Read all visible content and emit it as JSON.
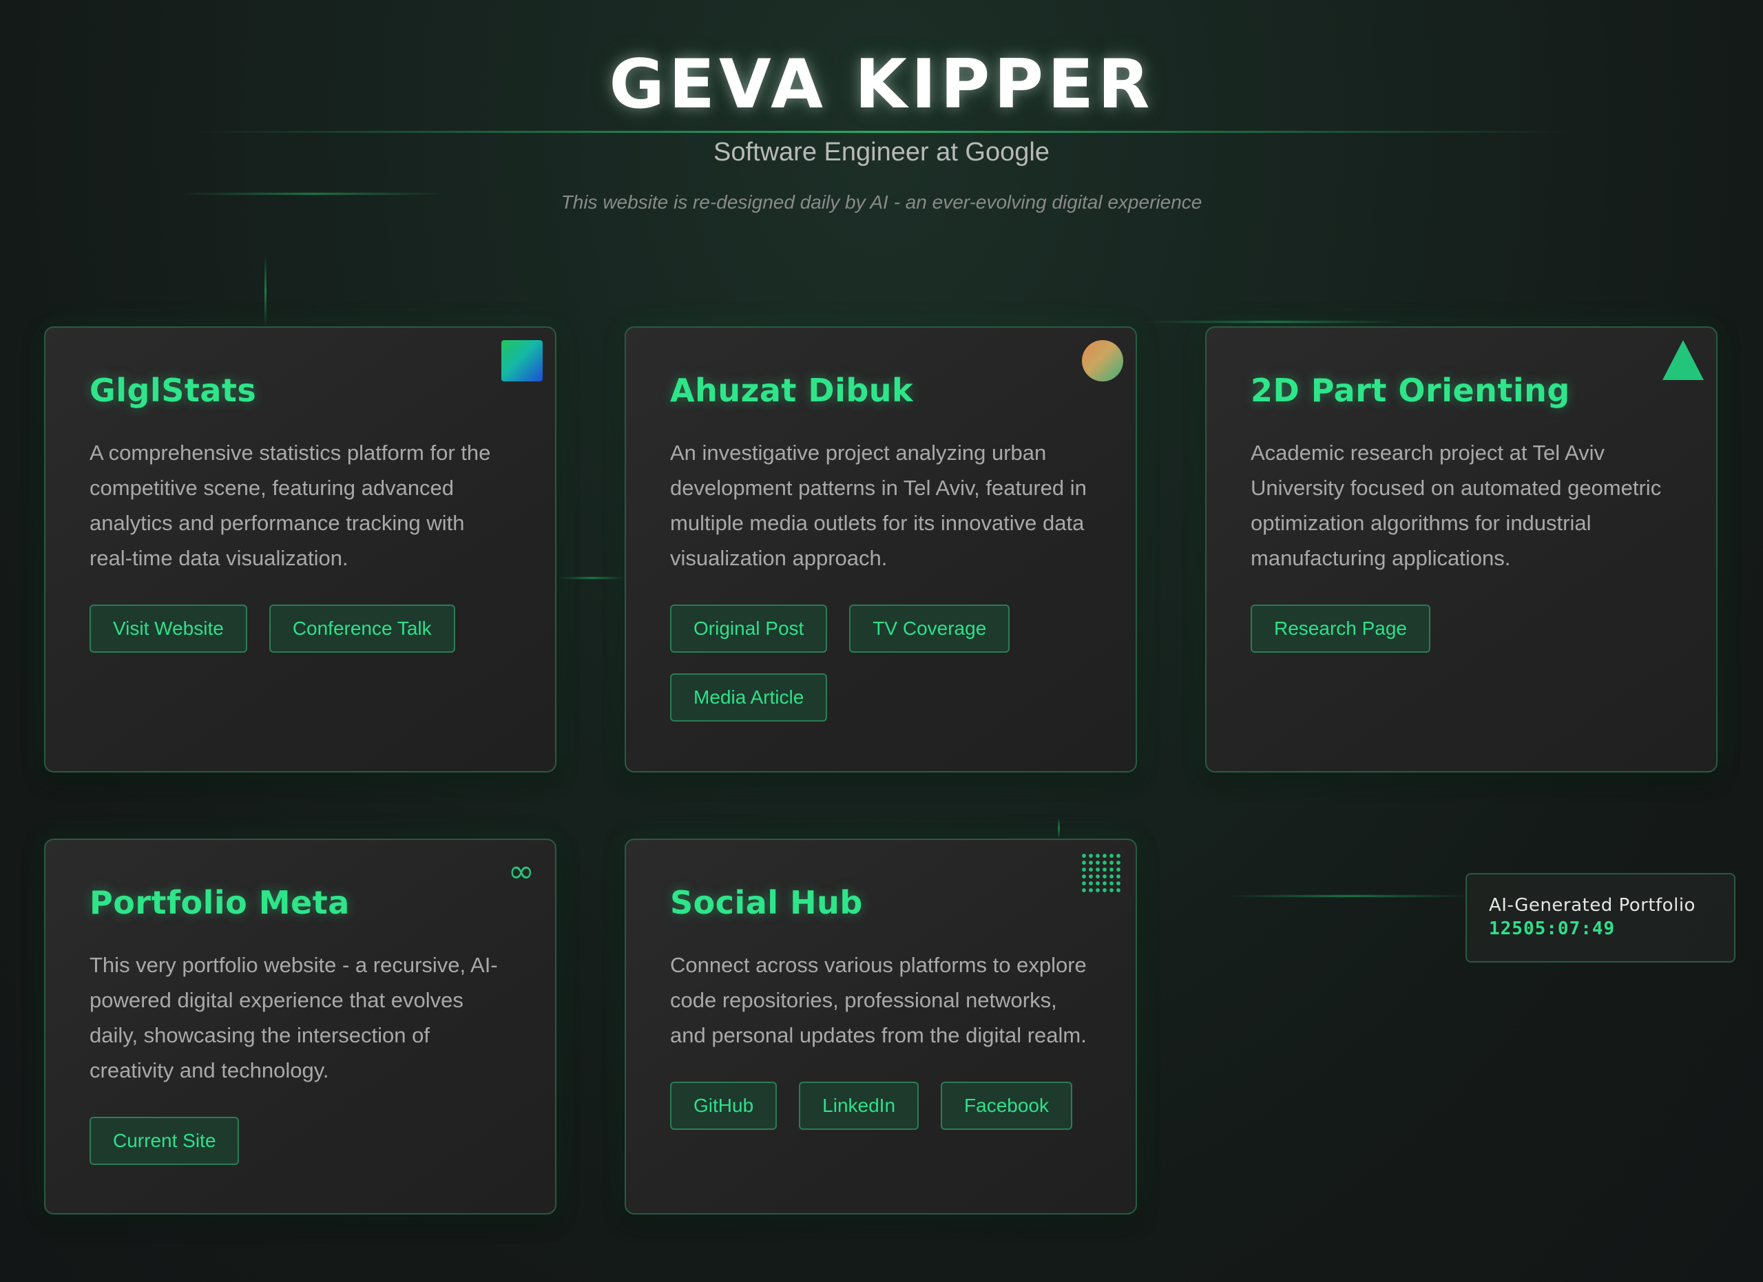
{
  "header": {
    "title": "GEVA KIPPER",
    "subtitle": "Software Engineer at Google",
    "tagline": "This website is re-designed daily by AI - an ever-evolving digital experience"
  },
  "cards": [
    {
      "title": "GlglStats",
      "description": "A comprehensive statistics platform for the competitive scene, featuring advanced analytics and performance tracking with real-time data visualization.",
      "icon": "gradient-square-icon",
      "buttons": [
        "Visit Website",
        "Conference Talk"
      ]
    },
    {
      "title": "Ahuzat Dibuk",
      "description": "An investigative project analyzing urban development patterns in Tel Aviv, featured in multiple media outlets for its innovative data visualization approach.",
      "icon": "gradient-circle-icon",
      "buttons": [
        "Original Post",
        "TV Coverage",
        "Media Article"
      ]
    },
    {
      "title": "2D Part Orienting",
      "description": "Academic research project at Tel Aviv University focused on automated geometric optimization algorithms for industrial manufacturing applications.",
      "icon": "triangle-icon",
      "buttons": [
        "Research Page"
      ]
    },
    {
      "title": "Portfolio Meta",
      "description": "This very portfolio website - a recursive, AI-powered digital experience that evolves daily, showcasing the intersection of creativity and technology.",
      "icon": "infinity-icon",
      "icon_glyph": "∞",
      "buttons": [
        "Current Site"
      ]
    },
    {
      "title": "Social Hub",
      "description": "Connect across various platforms to explore code repositories, professional networks, and personal updates from the digital realm.",
      "icon": "dot-grid-icon",
      "buttons": [
        "GitHub",
        "LinkedIn",
        "Facebook"
      ]
    }
  ],
  "ai_badge": {
    "label": "AI-Generated Portfolio",
    "clock": "12505:07:49"
  },
  "colors": {
    "accent": "#2fe58a",
    "background": "#151b19",
    "card": "#262626",
    "border": "#2a5a43"
  }
}
